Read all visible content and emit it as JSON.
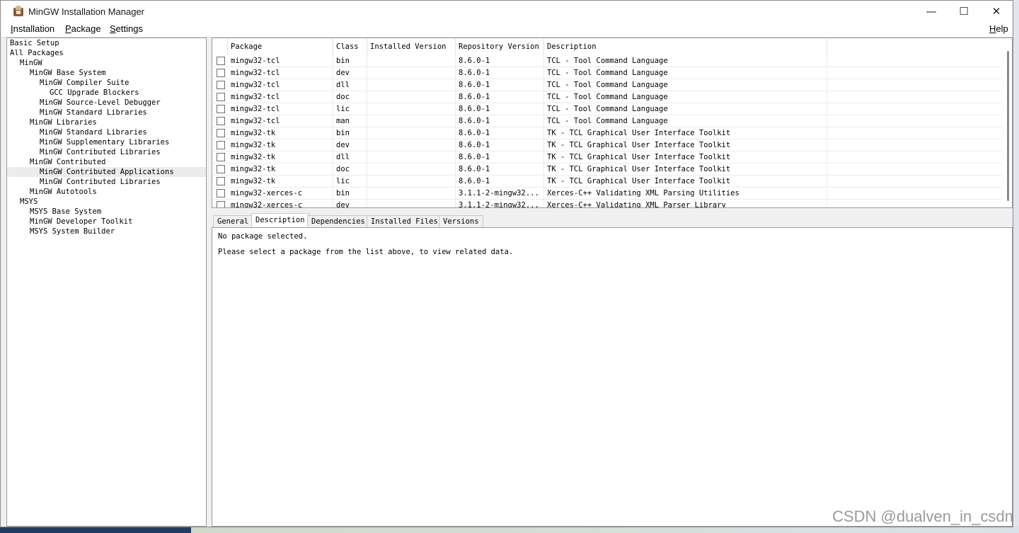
{
  "window": {
    "title": "MinGW Installation Manager",
    "controls": {
      "minimize": "—",
      "maximize": "☐",
      "close": "✕"
    }
  },
  "menu": {
    "installation": {
      "first": "I",
      "rest": "nstallation"
    },
    "package": {
      "first": "P",
      "rest": "ackage"
    },
    "settings": {
      "first": "S",
      "rest": "ettings"
    },
    "help": {
      "first": "H",
      "rest": "elp"
    }
  },
  "tree": {
    "items": [
      "Basic Setup",
      "All Packages",
      "MinGW",
      "MinGW Base System",
      "MinGW Compiler Suite",
      "GCC Upgrade Blockers",
      "MinGW Source-Level Debugger",
      "MinGW Standard Libraries",
      "MinGW Libraries",
      "MinGW Standard Libraries",
      "MinGW Supplementary Libraries",
      "MinGW Contributed Libraries",
      "MinGW Contributed",
      "MinGW Contributed Applications",
      "MinGW Contributed Libraries",
      "MinGW Autotools",
      "MSYS",
      "MSYS Base System",
      "MinGW Developer Toolkit",
      "MSYS System Builder"
    ],
    "selected_index": 13
  },
  "package_list": {
    "columns": [
      "Package",
      "Class",
      "Installed Version",
      "Repository Version",
      "Description"
    ],
    "rows": [
      [
        "mingw32-tcl",
        "bin",
        "",
        "8.6.0-1",
        "TCL - Tool Command Language"
      ],
      [
        "mingw32-tcl",
        "dev",
        "",
        "8.6.0-1",
        "TCL - Tool Command Language"
      ],
      [
        "mingw32-tcl",
        "dll",
        "",
        "8.6.0-1",
        "TCL - Tool Command Language"
      ],
      [
        "mingw32-tcl",
        "doc",
        "",
        "8.6.0-1",
        "TCL - Tool Command Language"
      ],
      [
        "mingw32-tcl",
        "lic",
        "",
        "8.6.0-1",
        "TCL - Tool Command Language"
      ],
      [
        "mingw32-tcl",
        "man",
        "",
        "8.6.0-1",
        "TCL - Tool Command Language"
      ],
      [
        "mingw32-tk",
        "bin",
        "",
        "8.6.0-1",
        "TK - TCL Graphical User Interface Toolkit"
      ],
      [
        "mingw32-tk",
        "dev",
        "",
        "8.6.0-1",
        "TK - TCL Graphical User Interface Toolkit"
      ],
      [
        "mingw32-tk",
        "dll",
        "",
        "8.6.0-1",
        "TK - TCL Graphical User Interface Toolkit"
      ],
      [
        "mingw32-tk",
        "doc",
        "",
        "8.6.0-1",
        "TK - TCL Graphical User Interface Toolkit"
      ],
      [
        "mingw32-tk",
        "lic",
        "",
        "8.6.0-1",
        "TK - TCL Graphical User Interface Toolkit"
      ],
      [
        "mingw32-xerces-c",
        "bin",
        "",
        "3.1.1-2-mingw32...",
        "Xerces-C++ Validating XML Parsing Utilities"
      ],
      [
        "mingw32-xerces-c",
        "dev",
        "",
        "3.1.1-2-mingw32...",
        "Xerces-C++ Validating XML Parser Library"
      ]
    ]
  },
  "tabs": [
    "General",
    "Description",
    "Dependencies",
    "Installed Files",
    "Versions"
  ],
  "active_tab": "Description",
  "details": {
    "line1": "No package selected.",
    "line2": "Please select a package from the list above, to view related data."
  },
  "watermark": "CSDN @dualven_in_csdn"
}
